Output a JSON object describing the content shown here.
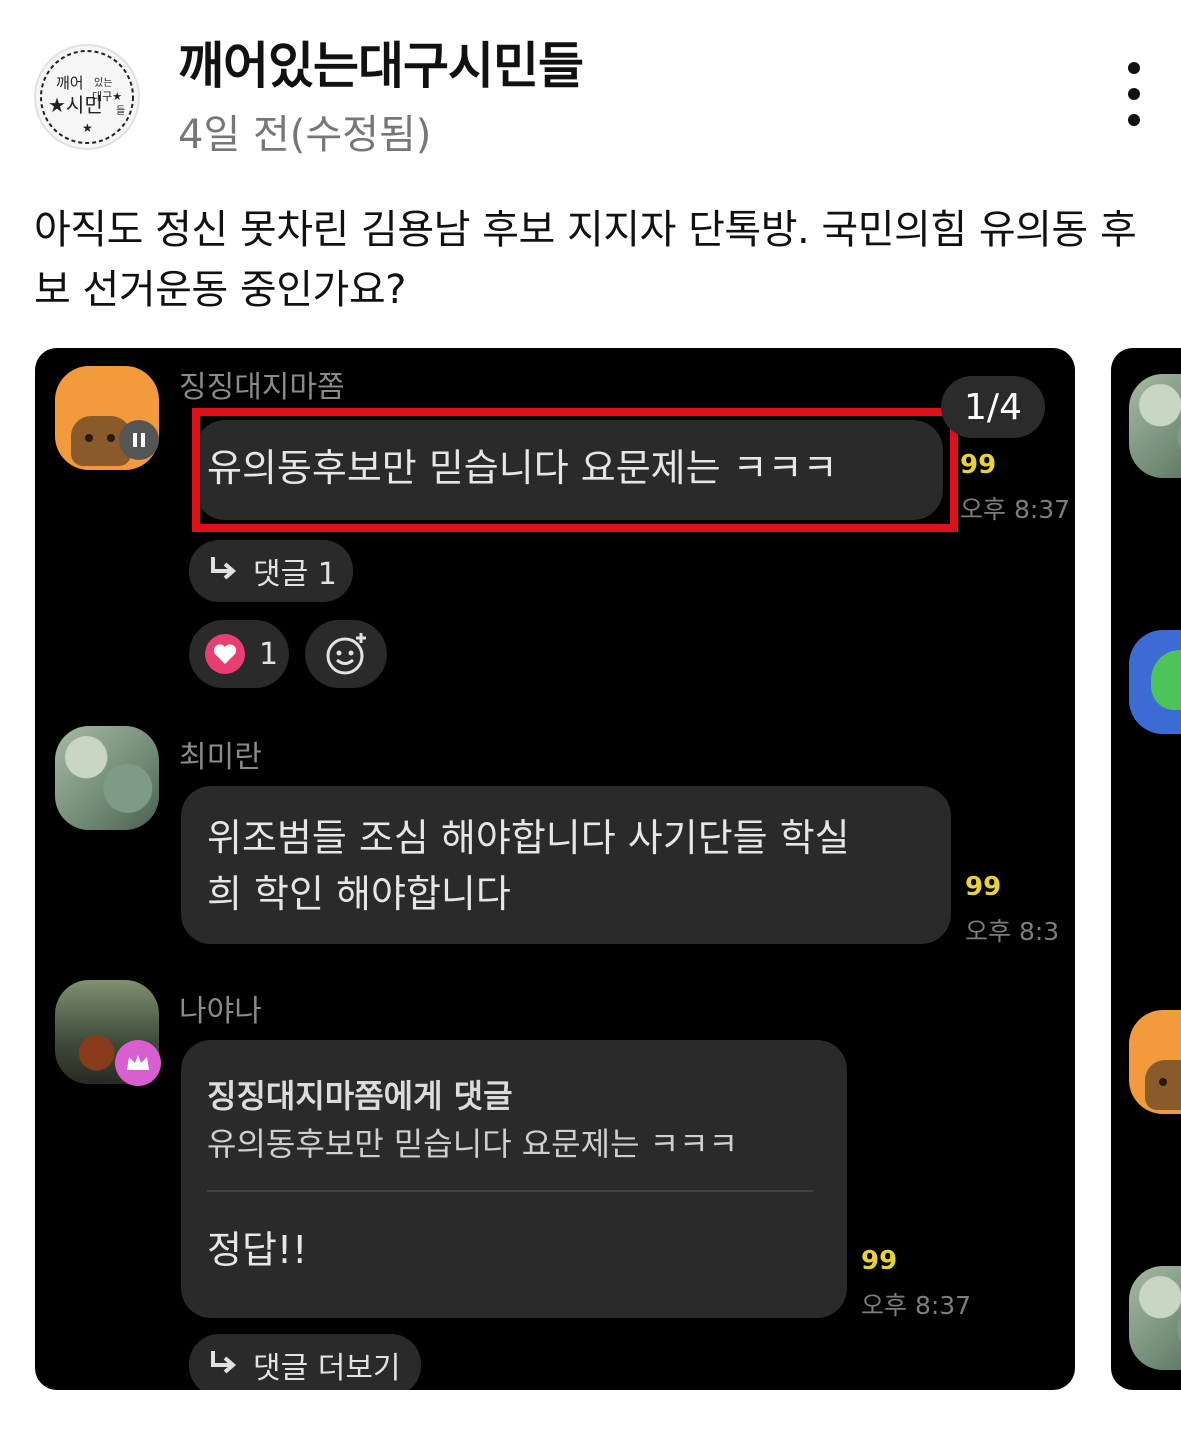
{
  "post": {
    "author": "깨어있는대구시민들",
    "timestamp": "4일 전(수정됨)",
    "body": "아직도 정신 못차린 김용남 후보 지지자 단톡방. 국민의힘 유의동 후보 선거운동 중인가요?",
    "avatar_logo_text": "깨어있는 대구★ 시민들"
  },
  "carousel": {
    "counter": "1/4",
    "messages": [
      {
        "sender": "징징대지마쫌",
        "text": "유의동후보만 믿습니다 요문제는 ㅋㅋㅋ",
        "unread": "99",
        "time": "오후 8:37",
        "reply_label": "댓글 1",
        "reaction_count": "1"
      },
      {
        "sender": "최미란",
        "lines": [
          "위조범들 조심 해야합니다 사기단들 학실",
          "희 학인 해야합니다"
        ],
        "unread": "99",
        "time": "오후 8:3"
      },
      {
        "sender": "나야나",
        "quote_header": "징징대지마쫌에게 댓글",
        "quote_text": "유의동후보만 믿습니다 요문제는 ㅋㅋㅋ",
        "text": "정답!!",
        "unread": "99",
        "time": "오후 8:37",
        "more_label": "댓글 더보기"
      }
    ]
  },
  "colors": {
    "highlight": "#e0101a",
    "unread": "#e8d23a",
    "heart": "#ea3d72"
  }
}
